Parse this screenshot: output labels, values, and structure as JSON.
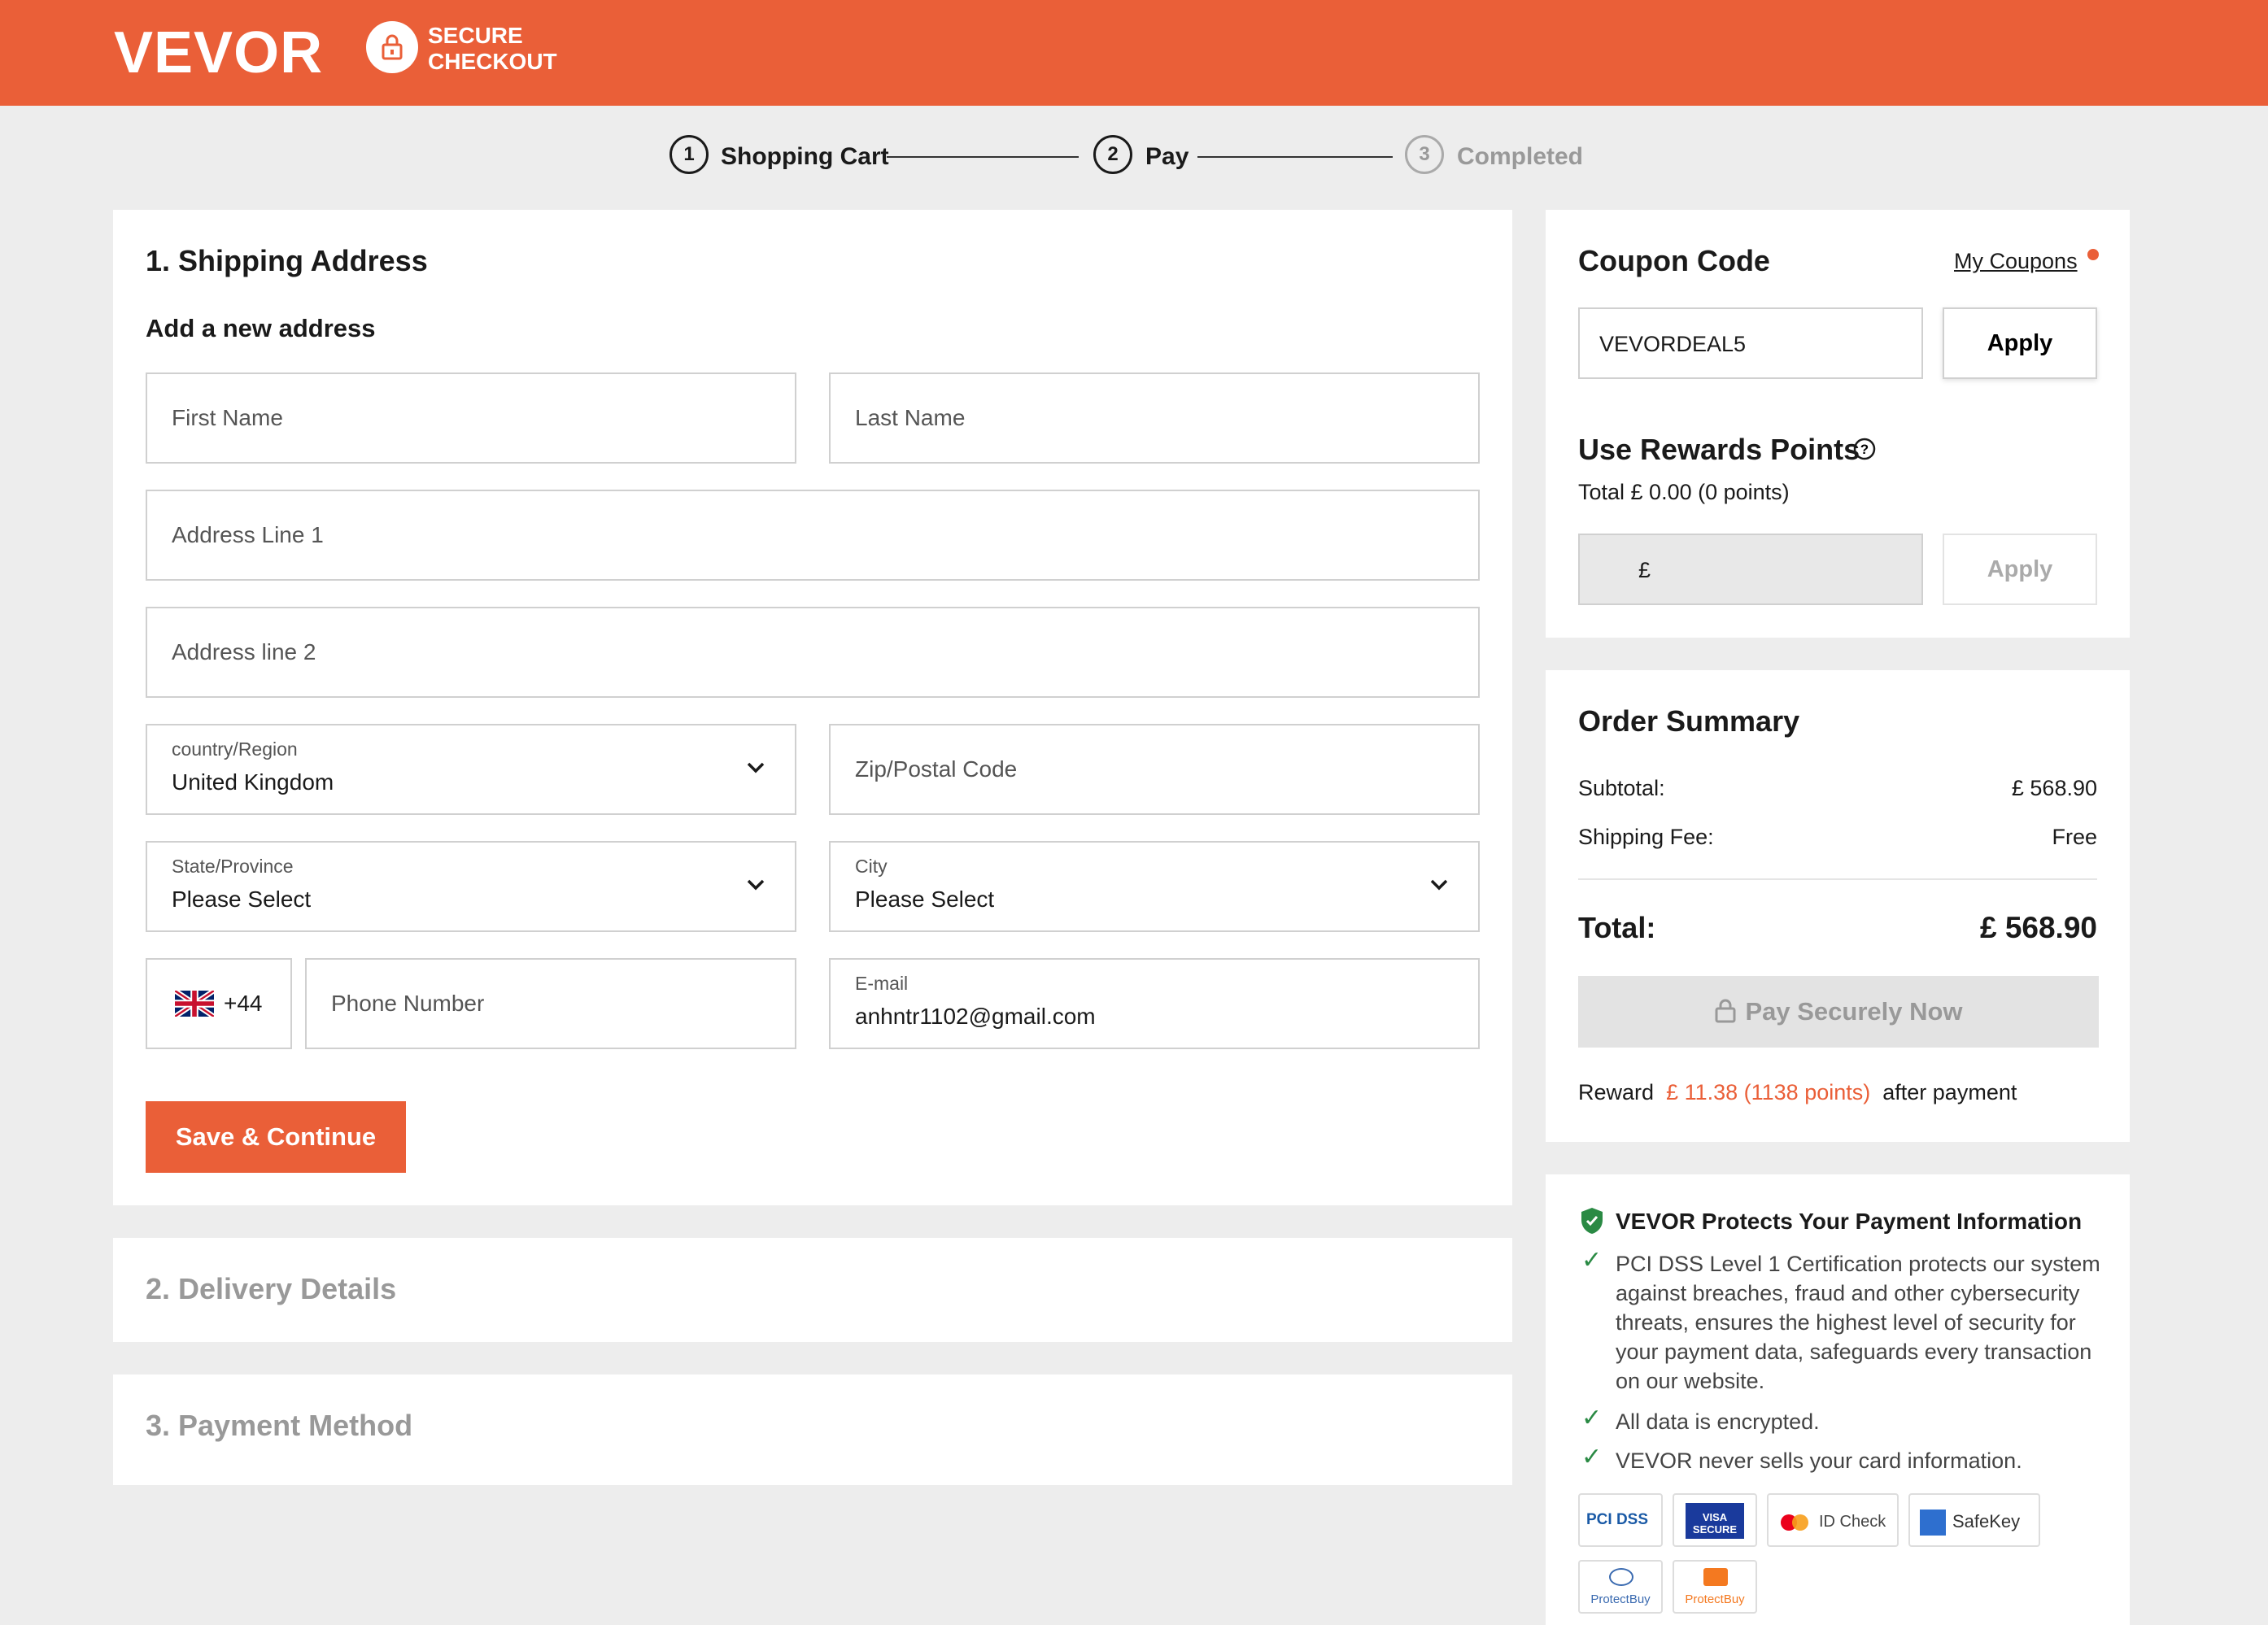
{
  "header": {
    "logo": "VEVOR",
    "secure_line1": "SECURE",
    "secure_line2": "CHECKOUT"
  },
  "steps": [
    {
      "num": "1",
      "label": "Shopping Cart"
    },
    {
      "num": "2",
      "label": "Pay"
    },
    {
      "num": "3",
      "label": "Completed"
    }
  ],
  "shipping": {
    "title": "1. Shipping Address",
    "subtitle": "Add a new address",
    "first_name_ph": "First Name",
    "last_name_ph": "Last Name",
    "address1_ph": "Address Line 1",
    "address2_ph": "Address line 2",
    "country_label": "country/Region",
    "country_value": "United Kingdom",
    "zip_ph": "Zip/Postal Code",
    "state_label": "State/Province",
    "state_value": "Please Select",
    "city_label": "City",
    "city_value": "Please Select",
    "phone_code": "+44",
    "phone_ph": "Phone Number",
    "email_label": "E-mail",
    "email_value": "anhntr1102@gmail.com",
    "save_label": "Save & Continue"
  },
  "delivery": {
    "title": "2. Delivery Details"
  },
  "payment": {
    "title": "3. Payment Method"
  },
  "coupon": {
    "title": "Coupon Code",
    "my_coupons": "My Coupons",
    "value": "VEVORDEAL5",
    "apply": "Apply"
  },
  "rewards": {
    "title": "Use Rewards Points",
    "total_text": "Total  £ 0.00 (0 points)",
    "currency_symbol": "£",
    "apply": "Apply"
  },
  "summary": {
    "title": "Order Summary",
    "subtotal_label": "Subtotal:",
    "subtotal_value": "£ 568.90",
    "shipping_label": "Shipping Fee:",
    "shipping_value": "Free",
    "total_label": "Total:",
    "total_value": "£ 568.90",
    "pay_label": "Pay Securely Now",
    "reward_prefix": "Reward",
    "reward_amount": "£ 11.38 (1138 points)",
    "reward_suffix": "after payment"
  },
  "protect": {
    "title": "VEVOR Protects Your Payment Information",
    "item1": [
      "PCI DSS Level 1 Certification protects our system",
      "against breaches, fraud and other cybersecurity",
      "threats, ensures the highest level of security for",
      "your payment data, safeguards every transaction",
      "on our website."
    ],
    "item2": "All data is encrypted.",
    "item3": "VEVOR never sells your card information.",
    "badges": [
      "PCI DSS",
      "VISA SECURE",
      "ID Check",
      "SafeKey",
      "ProtectBuy",
      "ProtectBuy"
    ]
  },
  "colors": {
    "brand": "#ea5f38",
    "success": "#2a8a44"
  }
}
